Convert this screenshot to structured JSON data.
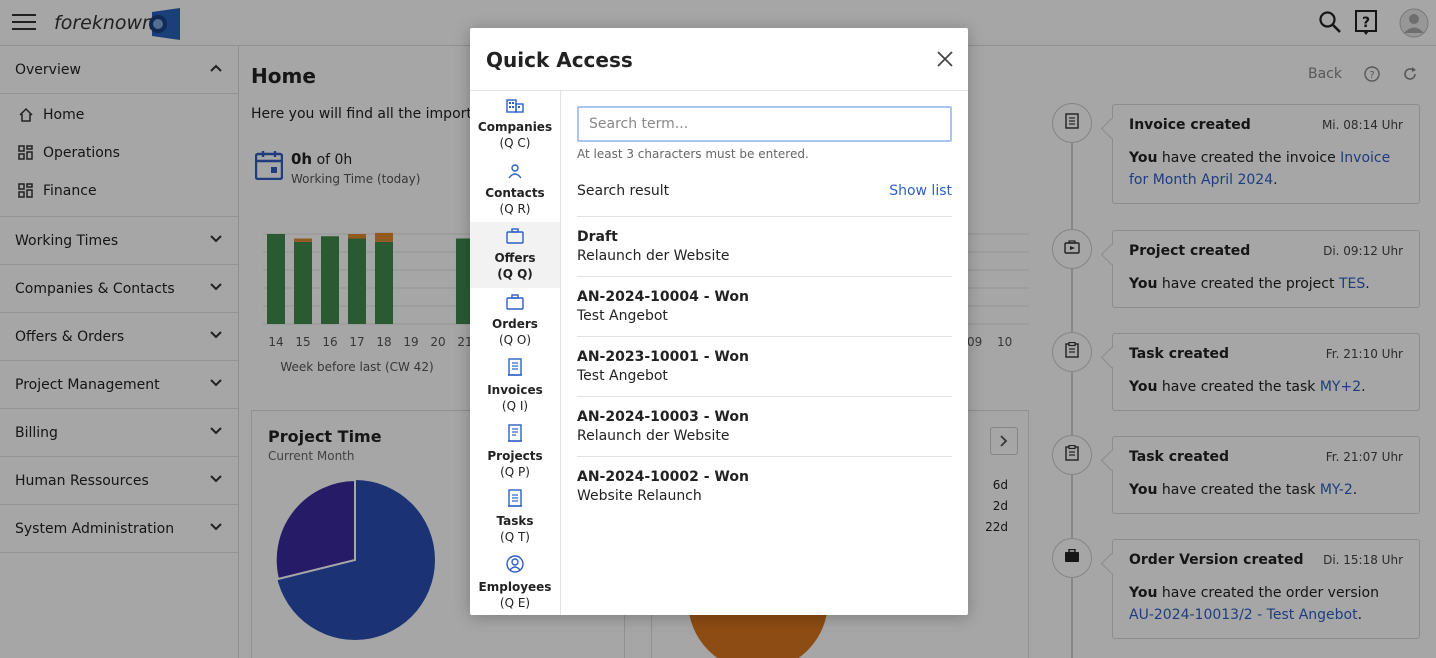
{
  "app": {
    "logo_text": "foreknown"
  },
  "sidebar": {
    "overview": "Overview",
    "sub_items": [
      {
        "label": "Home",
        "icon": "home-icon"
      },
      {
        "label": "Operations",
        "icon": "grid-icon"
      },
      {
        "label": "Finance",
        "icon": "grid-icon"
      }
    ],
    "sections": [
      "Working Times",
      "Companies & Contacts",
      "Offers & Orders",
      "Project Management",
      "Billing",
      "Human Ressources",
      "System Administration"
    ]
  },
  "main": {
    "title": "Home",
    "intro": "Here you will find all the important",
    "back": "Back",
    "working_time": {
      "hours": "0h",
      "of": "of 0h",
      "label": "Working Time (today)"
    },
    "project_time": {
      "title": "Project Time",
      "subtitle": "Current Month"
    },
    "right_values": [
      "6d",
      "2d",
      "22d"
    ]
  },
  "chart_data": {
    "type": "bar",
    "categories": [
      "14",
      "15",
      "16",
      "17",
      "18",
      "19",
      "20",
      "21"
    ],
    "series": [
      {
        "values": [
          8,
          7.3,
          7.8,
          7.6,
          7.3,
          0,
          0,
          7.6
        ]
      },
      {
        "values": [
          0,
          0.3,
          0,
          0.4,
          0.8,
          0,
          0,
          0
        ]
      }
    ],
    "xlabel": "Week before last (CW 42)",
    "ylim": [
      0,
      8
    ],
    "grid": true
  },
  "timeline": [
    {
      "icon": "invoice-icon",
      "title": "Invoice created",
      "time": "Mi. 08:14 Uhr",
      "you": "You",
      "text": "have created the invoice",
      "link": "Invoice for Month April 2024",
      "end": "."
    },
    {
      "icon": "project-icon",
      "title": "Project created",
      "time": "Di. 09:12 Uhr",
      "you": "You",
      "text": "have created the project",
      "link": "TES",
      "end": "."
    },
    {
      "icon": "task-icon",
      "title": "Task created",
      "time": "Fr. 21:10 Uhr",
      "you": "You",
      "text": "have created the task",
      "link": "MY+2",
      "end": "."
    },
    {
      "icon": "task-icon",
      "title": "Task created",
      "time": "Fr. 21:07 Uhr",
      "you": "You",
      "text": "have created the task",
      "link": "MY-2",
      "end": "."
    },
    {
      "icon": "briefcase-icon",
      "title": "Order Version created",
      "time": "Di. 15:18 Uhr",
      "you": "You",
      "text": "have created the order version",
      "link": "AU-2024-10013/2 - Test Angebot",
      "end": "."
    }
  ],
  "modal": {
    "title": "Quick Access",
    "nav": [
      {
        "label": "Companies",
        "shortcut": "(Q C)",
        "icon": "building-icon"
      },
      {
        "label": "Contacts",
        "shortcut": "(Q R)",
        "icon": "person-icon"
      },
      {
        "label": "Offers",
        "shortcut": "(Q Q)",
        "icon": "briefcase-icon"
      },
      {
        "label": "Orders",
        "shortcut": "(Q O)",
        "icon": "briefcase-icon"
      },
      {
        "label": "Invoices",
        "shortcut": "(Q I)",
        "icon": "invoice-icon"
      },
      {
        "label": "Projects",
        "shortcut": "(Q P)",
        "icon": "project-icon"
      },
      {
        "label": "Tasks",
        "shortcut": "(Q T)",
        "icon": "task-icon"
      },
      {
        "label": "Employees",
        "shortcut": "(Q E)",
        "icon": "employee-icon"
      }
    ],
    "search_placeholder": "Search term...",
    "hint": "At least 3 characters must be entered.",
    "result_label": "Search result",
    "show_list": "Show list",
    "results": [
      {
        "title": "Draft",
        "subtitle": "Relaunch der Website"
      },
      {
        "title": "AN-2024-10004 - Won",
        "subtitle": "Test Angebot"
      },
      {
        "title": "AN-2023-10001 - Won",
        "subtitle": "Test Angebot"
      },
      {
        "title": "AN-2024-10003 - Won",
        "subtitle": "Relaunch der Website"
      },
      {
        "title": "AN-2024-10002 - Won",
        "subtitle": "Website Relaunch"
      }
    ]
  }
}
